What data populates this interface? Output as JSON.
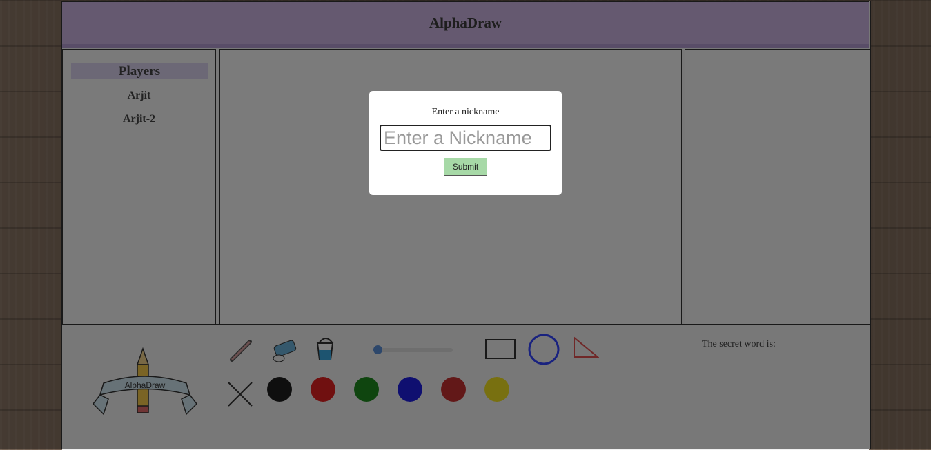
{
  "app": {
    "title": "AlphaDraw"
  },
  "players": {
    "heading": "Players",
    "list": [
      "Arjit",
      "Arjit-2"
    ]
  },
  "logo": {
    "text": "AlphaDraw"
  },
  "toolbar": {
    "tools": [
      "pencil-icon",
      "eraser-icon",
      "paint-bucket-icon"
    ],
    "brush_size": 0.0,
    "shapes": [
      "rectangle-icon",
      "circle-icon",
      "triangle-icon"
    ],
    "clear": "clear-icon",
    "colors": [
      "#1f1f1f",
      "#e02020",
      "#1e8a1e",
      "#1e1ee0",
      "#c53030",
      "#f0e020"
    ],
    "shape_colors": {
      "circle": "#3344ff",
      "triangle": "#e05050",
      "rectangle": "#333333"
    }
  },
  "game": {
    "secret_word_label": "The secret word is:"
  },
  "modal": {
    "label": "Enter a nickname",
    "placeholder": "Enter a Nickname",
    "submit": "Submit"
  }
}
